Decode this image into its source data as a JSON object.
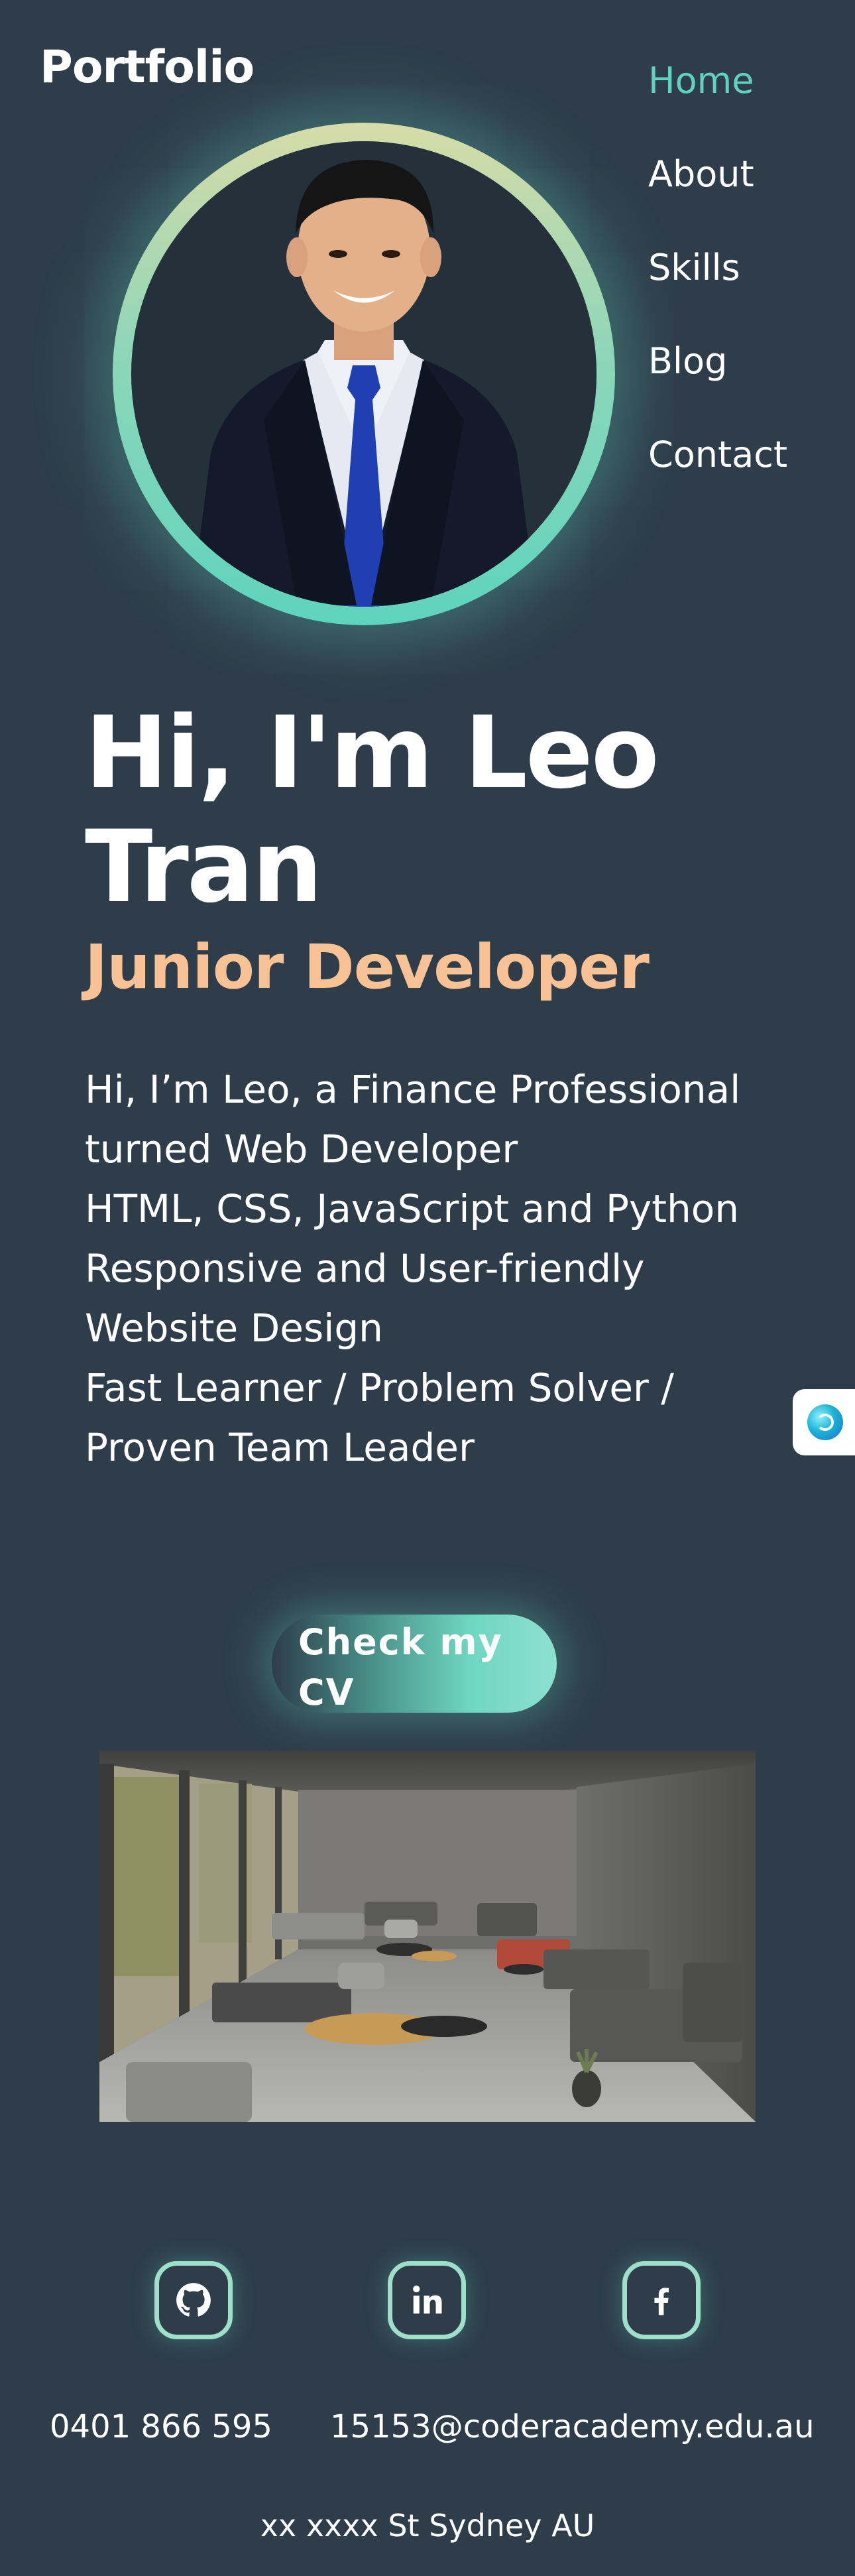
{
  "header": {
    "brand": "Portfolio"
  },
  "nav": {
    "items": [
      {
        "label": "Home",
        "active": true
      },
      {
        "label": "About",
        "active": false
      },
      {
        "label": "Skills",
        "active": false
      },
      {
        "label": "Blog",
        "active": false
      },
      {
        "label": "Contact",
        "active": false
      }
    ]
  },
  "hero": {
    "title": "Hi, I'm Leo Tran",
    "role": "Junior Developer",
    "description": [
      "Hi, I’m Leo, a Finance Professional",
      "turned Web Developer",
      "HTML, CSS, JavaScript and Python",
      "Responsive and User-friendly",
      "Website Design",
      "Fast Learner / Problem Solver /",
      "Proven Team Leader"
    ],
    "cv_button": "Check my CV"
  },
  "socials": [
    {
      "icon": "github-icon"
    },
    {
      "icon": "linkedin-icon"
    },
    {
      "icon": "facebook-icon"
    }
  ],
  "footer": {
    "phone": "0401 866 595",
    "email": "15153@coderacademy.edu.au",
    "address": "xx xxxx St Sydney AU"
  },
  "colors": {
    "background": "#2e3d49",
    "accent": "#5fd3bd",
    "role": "#f9c294",
    "text": "#ffffff"
  }
}
